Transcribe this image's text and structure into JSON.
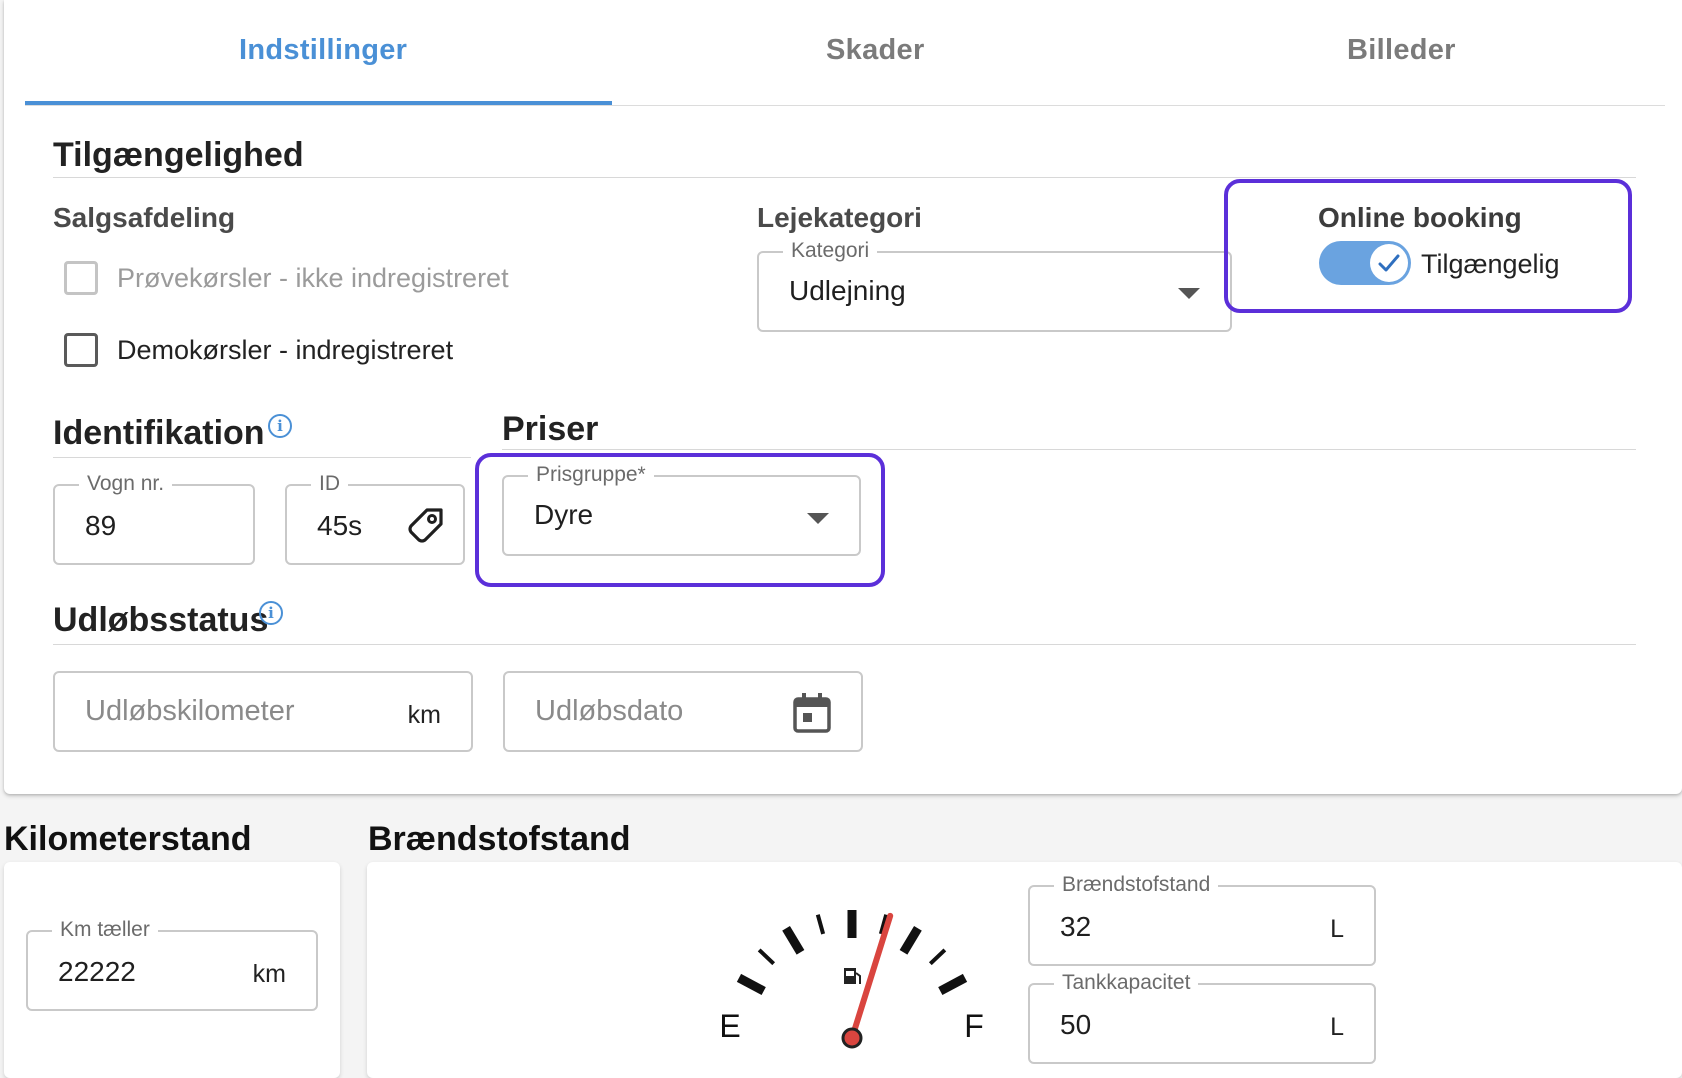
{
  "tabs": [
    {
      "label": "Indstillinger",
      "active": true
    },
    {
      "label": "Skader",
      "active": false
    },
    {
      "label": "Billeder",
      "active": false
    }
  ],
  "availability": {
    "title": "Tilgængelighed",
    "sales_department": {
      "label": "Salgsafdeling",
      "options": [
        {
          "label": "Prøvekørsler - ikke indregistreret",
          "checked": false,
          "disabled": true
        },
        {
          "label": "Demokørsler - indregistreret",
          "checked": false,
          "disabled": false
        }
      ]
    },
    "rental_category": {
      "label": "Lejekategori",
      "field_label": "Kategori",
      "value": "Udlejning"
    },
    "online_booking": {
      "label": "Online booking",
      "toggle_label": "Tilgængelig",
      "enabled": true
    }
  },
  "identification": {
    "title": "Identifikation",
    "vogn_nr": {
      "label": "Vogn nr.",
      "value": "89"
    },
    "id": {
      "label": "ID",
      "value": "45s"
    }
  },
  "prices": {
    "title": "Priser",
    "price_group": {
      "label": "Prisgruppe*",
      "value": "Dyre"
    }
  },
  "expiry": {
    "title": "Udløbsstatus",
    "km_placeholder": "Udløbskilometer",
    "km_unit": "km",
    "date_placeholder": "Udløbsdato"
  },
  "odometer": {
    "title": "Kilometerstand",
    "field_label": "Km tæller",
    "value": "22222",
    "unit": "km"
  },
  "fuel": {
    "title": "Brændstofstand",
    "gauge": {
      "empty_label": "E",
      "full_label": "F",
      "level_fraction": 0.64
    },
    "level": {
      "label": "Brændstofstand",
      "value": "32",
      "unit": "L"
    },
    "capacity": {
      "label": "Tankkapacitet",
      "value": "50",
      "unit": "L"
    }
  },
  "colors": {
    "accent": "#4a90d6",
    "highlight": "#5b2fd9",
    "needle": "#d9453f"
  }
}
